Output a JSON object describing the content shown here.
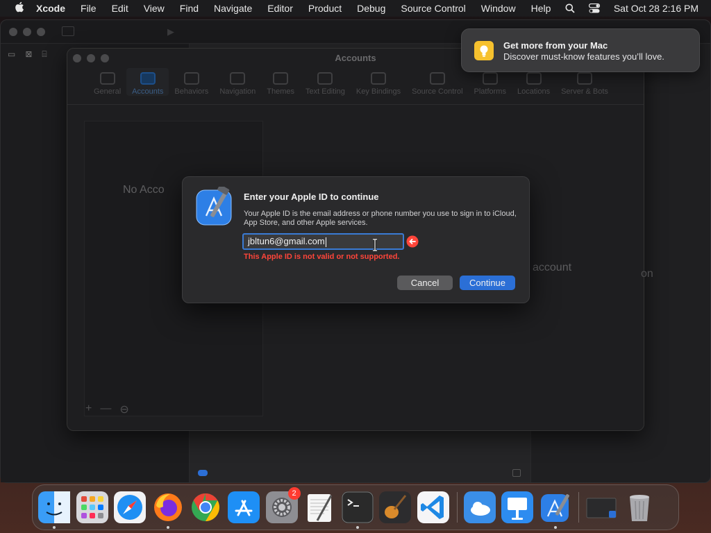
{
  "menubar": {
    "app_name": "Xcode",
    "items": [
      "File",
      "Edit",
      "View",
      "Find",
      "Navigate",
      "Editor",
      "Product",
      "Debug",
      "Source Control",
      "Window",
      "Help"
    ],
    "clock": "Sat Oct 28  2:16 PM"
  },
  "prefs": {
    "title": "Accounts",
    "tabs": [
      "General",
      "Accounts",
      "Behaviors",
      "Navigation",
      "Themes",
      "Text Editing",
      "Key Bindings",
      "Source Control",
      "Platforms",
      "Locations",
      "Server & Bots"
    ],
    "active_tab": "Accounts",
    "no_accounts": "No Acco",
    "hint": "account",
    "edge": "on"
  },
  "dialog": {
    "title": "Enter your Apple ID to continue",
    "description": "Your Apple ID is the email address or phone number you use to sign in to iCloud, App Store, and other Apple services.",
    "email_value": "jbltun6@gmail.com",
    "error": "This Apple ID is not valid or not supported.",
    "cancel_label": "Cancel",
    "continue_label": "Continue"
  },
  "notification": {
    "title": "Get more from your Mac",
    "body": "Discover must-know features you’ll love."
  },
  "dock": {
    "apps": [
      "Finder",
      "Launchpad",
      "Safari",
      "Firefox",
      "Chrome",
      "App Store",
      "System Settings",
      "TextEdit",
      "Terminal",
      "GarageBand",
      "Visual Studio Code",
      "Weather",
      "Keynote",
      "Xcode",
      "Screen",
      "Trash"
    ],
    "settings_badge": "2"
  },
  "colors": {
    "accent": "#2b6fd6",
    "error": "#ff453a"
  }
}
